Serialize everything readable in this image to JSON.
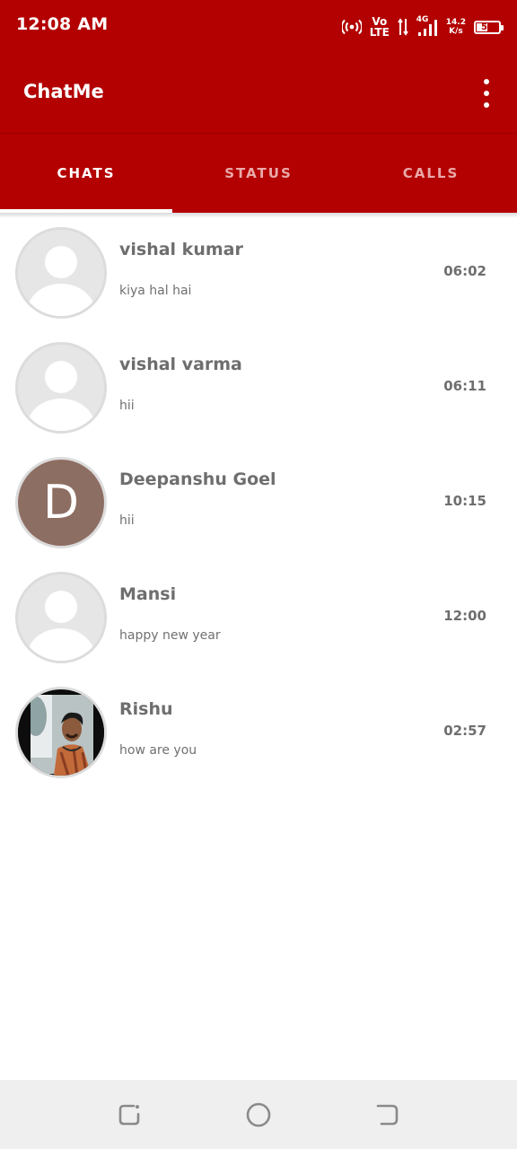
{
  "status_bar": {
    "time": "12:08 AM",
    "volte_top": "Vo",
    "volte_bottom": "LTE",
    "network": "4G",
    "speed_top": "14.2",
    "speed_bottom": "K/s",
    "battery": "54",
    "battery_level": 0.54
  },
  "app_bar": {
    "title": "ChatMe",
    "menu_icon": "more-vertical-icon"
  },
  "tabs": [
    {
      "label": "CHATS",
      "active": true
    },
    {
      "label": "STATUS",
      "active": false
    },
    {
      "label": "CALLS",
      "active": false
    }
  ],
  "chats": [
    {
      "name": "vishal kumar",
      "message": "kiya hal hai",
      "time": "06:02",
      "avatar": "default-avatar-icon"
    },
    {
      "name": "vishal varma",
      "message": "hii",
      "time": "06:11",
      "avatar": "default-avatar-icon"
    },
    {
      "name": "Deepanshu Goel",
      "message": "hii",
      "time": "10:15",
      "avatar_letter": "D",
      "avatar_color": "#8d6e63"
    },
    {
      "name": "Mansi",
      "message": "happy new year",
      "time": "12:00",
      "avatar": "default-avatar-icon"
    },
    {
      "name": "Rishu",
      "message": "how are you",
      "time": "02:57",
      "avatar": "photo-avatar"
    }
  ],
  "colors": {
    "primary": "#b30000",
    "tab_inactive": "#e9a9a9",
    "text_gray": "#6e6e6e"
  },
  "nav_bar": {
    "icons": [
      "recents-icon",
      "home-icon",
      "back-icon"
    ]
  }
}
